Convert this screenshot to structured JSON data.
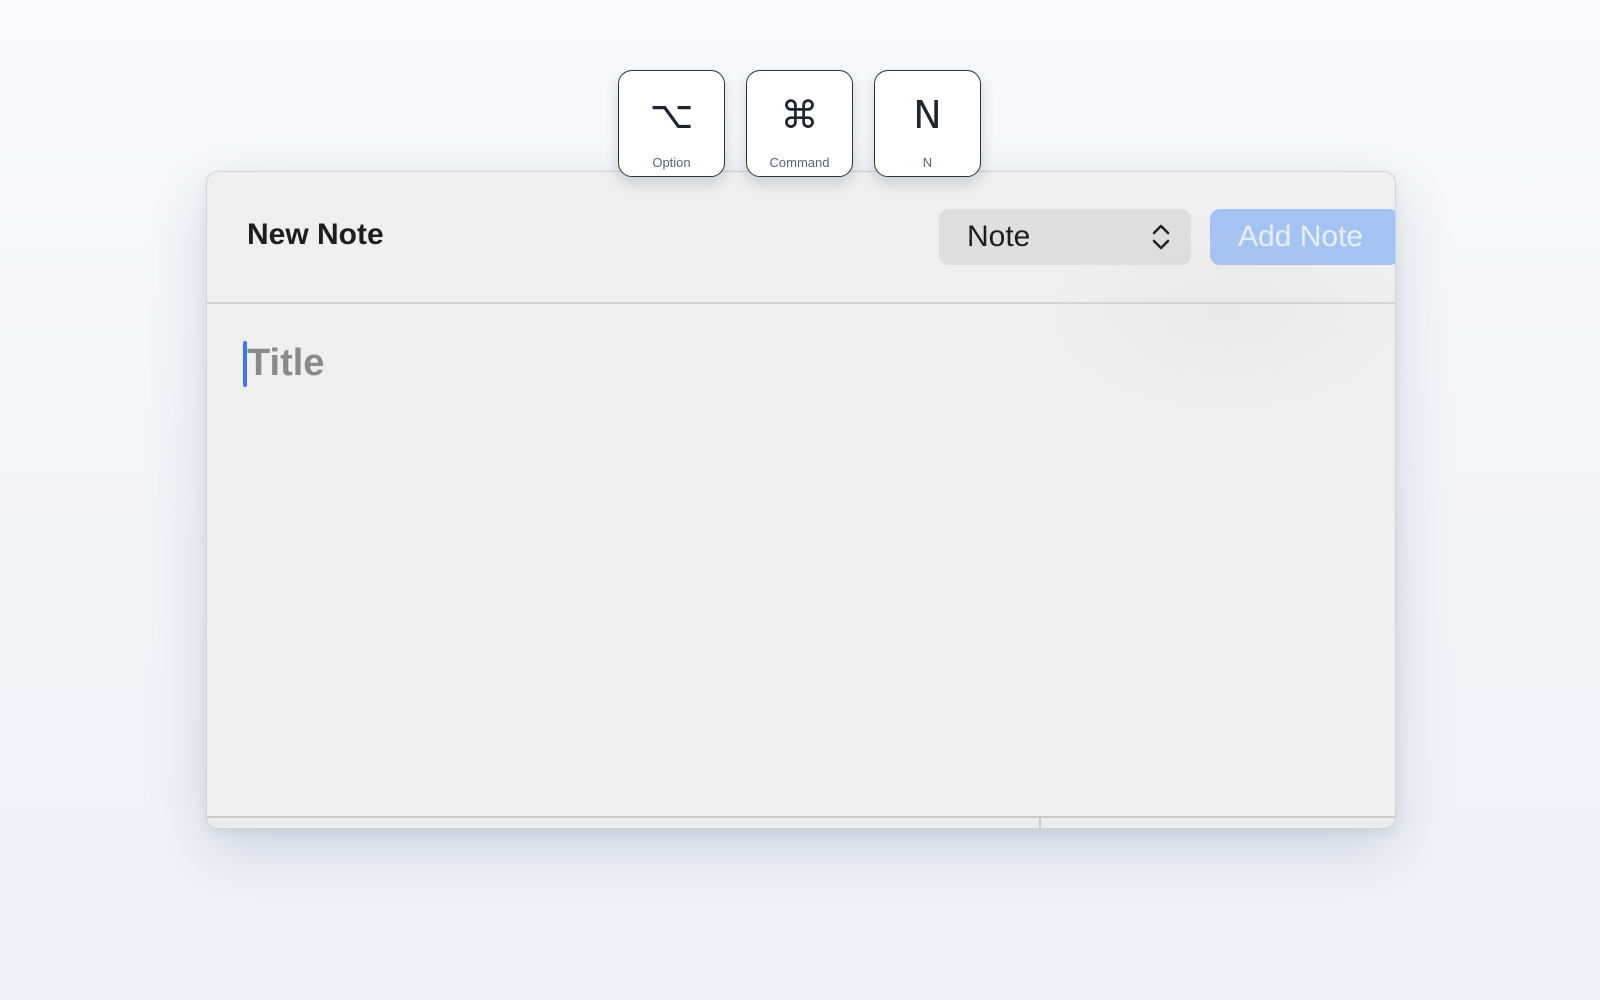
{
  "shortcut_overlay": {
    "keys": [
      {
        "glyph": "⌥",
        "label": "Option"
      },
      {
        "glyph": "⌘",
        "label": "Command"
      },
      {
        "glyph": "N",
        "label": "N"
      }
    ]
  },
  "window": {
    "title": "New Note",
    "type_select": {
      "selected": "Note",
      "icon": "up-down-chevron-icon"
    },
    "add_button_label": "Add Note",
    "title_field": {
      "placeholder": "Title",
      "value": ""
    }
  },
  "colors": {
    "accent": "#3f78e0",
    "add_button_disabled": "#a4c3f3",
    "window_background": "#efefef"
  }
}
